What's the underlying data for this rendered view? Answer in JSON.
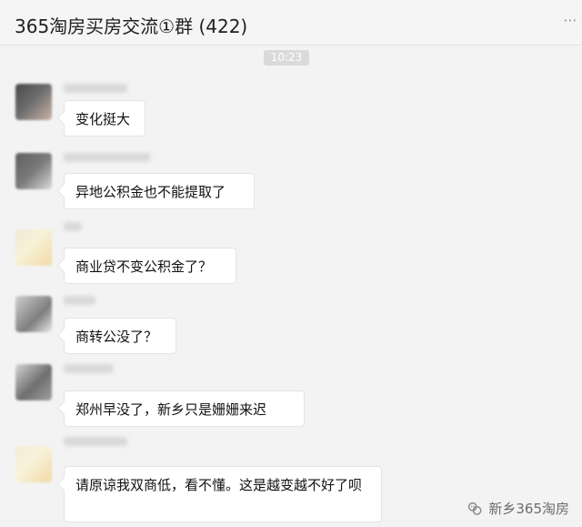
{
  "window": {
    "title": "365淘房买房交流①群 (422)",
    "more_icon": "ellipsis-icon"
  },
  "chat": {
    "timestamp": "10:23",
    "messages": [
      {
        "text": "变化挺大"
      },
      {
        "text": "异地公积金也不能提取了"
      },
      {
        "text": "商业贷不变公积金了？"
      },
      {
        "text": "商转公没了？"
      },
      {
        "text": "郑州早没了，新乡只是姗姗来迟"
      },
      {
        "text": "请原谅我双商低，看不懂。这是越变越不好了呗"
      }
    ]
  },
  "watermark": {
    "text": "新乡365淘房",
    "icon": "wechat-official-account-icon"
  },
  "colors": {
    "background": "#f3f3f3",
    "bubble": "#ffffff",
    "timestamp_bg": "#dadada"
  }
}
